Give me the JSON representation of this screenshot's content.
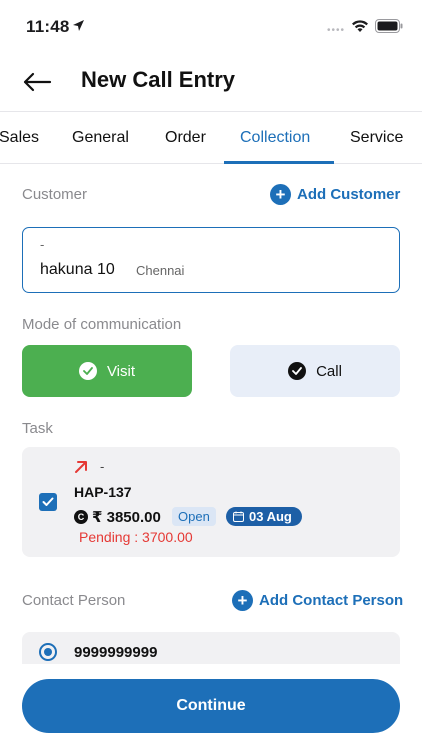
{
  "status_bar": {
    "time": "11:48",
    "signal": "••••"
  },
  "header": {
    "title": "New Call Entry"
  },
  "tabs": [
    {
      "label": "Sales"
    },
    {
      "label": "General"
    },
    {
      "label": "Order"
    },
    {
      "label": "Collection",
      "active": true
    },
    {
      "label": "Service"
    }
  ],
  "customer": {
    "label": "Customer",
    "add_label": "Add Customer",
    "code": "-",
    "name": "hakuna 10",
    "city": "Chennai"
  },
  "mode": {
    "label": "Mode of communication",
    "options": [
      {
        "label": "Visit",
        "selected": true
      },
      {
        "label": "Call",
        "selected": false
      }
    ]
  },
  "task": {
    "label": "Task",
    "dash": "-",
    "code": "HAP-137",
    "currency_icon": "C",
    "amount": "₹ 3850.00",
    "status": "Open",
    "date": "03 Aug",
    "pending": "Pending : 3700.00",
    "checked": true
  },
  "contact": {
    "label": "Contact Person",
    "add_label": "Add Contact Person",
    "phone": "9999999999"
  },
  "footer": {
    "continue_label": "Continue"
  },
  "colors": {
    "primary": "#1d6fb8",
    "visit_green": "#4caf50",
    "pending_red": "#e53935"
  }
}
